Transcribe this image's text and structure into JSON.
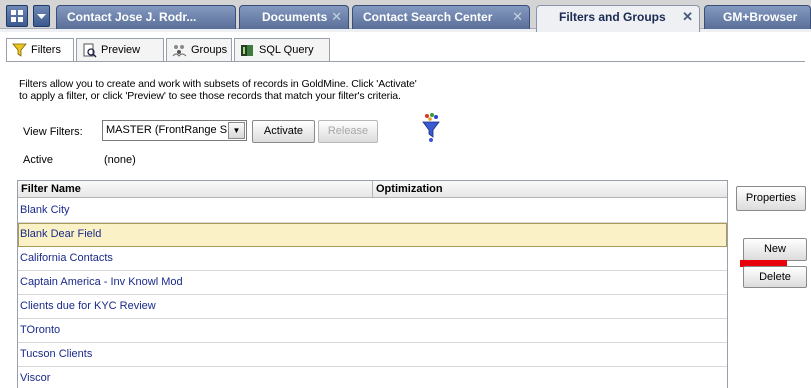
{
  "top_tabs": [
    {
      "label": "Contact Jose J. Rodr...",
      "closable": false,
      "active": false
    },
    {
      "label": "Documents",
      "closable": true,
      "active": false
    },
    {
      "label": "Contact Search Center",
      "closable": true,
      "active": false
    },
    {
      "label": "Filters and Groups",
      "closable": true,
      "active": true
    },
    {
      "label": "GM+Browser",
      "closable": false,
      "active": false
    }
  ],
  "sub_tabs": [
    {
      "label": "Filters",
      "icon": "funnel-icon"
    },
    {
      "label": "Preview",
      "icon": "preview-icon"
    },
    {
      "label": "Groups",
      "icon": "groups-icon"
    },
    {
      "label": "SQL Query",
      "icon": "sql-icon"
    }
  ],
  "description": {
    "line1": "Filters allow you to create and work with subsets of records in GoldMine.  Click 'Activate'",
    "line2": "to apply a filter, or click 'Preview' to see those records that match your filter's criteria."
  },
  "view_filters": {
    "label": "View Filters:",
    "selected": "MASTER (FrontRange S",
    "activate_label": "Activate",
    "release_label": "Release"
  },
  "active": {
    "label": "Active",
    "value": "(none)"
  },
  "table": {
    "columns": [
      "Filter Name",
      "Optimization"
    ],
    "rows": [
      {
        "name": "Blank City"
      },
      {
        "name": "Blank Dear Field"
      },
      {
        "name": "California Contacts"
      },
      {
        "name": "Captain America - Inv Knowl Mod"
      },
      {
        "name": "Clients due for KYC Review"
      },
      {
        "name": "TOronto"
      },
      {
        "name": "Tucson Clients"
      },
      {
        "name": "Viscor"
      }
    ],
    "selected_index": 1
  },
  "side_buttons": {
    "properties": "Properties",
    "new": "New",
    "delete": "Delete"
  },
  "colors": {
    "tab_blue": "#5a6f98",
    "selected_row": "#faf1c6",
    "link_blue": "#1a2a8a",
    "annotation_red": "#e8000a"
  }
}
